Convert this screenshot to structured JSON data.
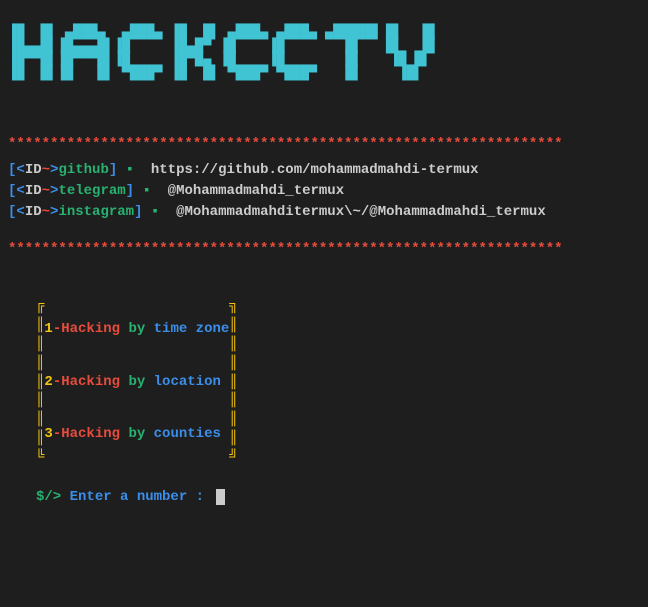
{
  "banner": " _     _ _______ _______ _     _ _______ _______ _______ _    _\n |_____| |_____| |       |____/  |       |          |     \\  /\n |     | |     | |_____  |    \\_ |_____  |_____     |      \\/",
  "separator": "******************************************************************",
  "info": [
    {
      "open": "[",
      "id_open": "<",
      "id": "ID",
      "tilde": "~",
      "id_close": ">",
      "key": "github",
      "close": "]",
      "dot": " ▪  ",
      "link": "https://github.com/mohammadmahdi-termux"
    },
    {
      "open": "[",
      "id_open": "<",
      "id": "ID",
      "tilde": "~",
      "id_close": ">",
      "key": "telegram",
      "close": "]",
      "dot": " ▪  ",
      "link": "@Mohammadmahdi_termux"
    },
    {
      "open": "[",
      "id_open": "<",
      "id": "ID",
      "tilde": "~",
      "id_close": ">",
      "key": "instagram",
      "close": "]",
      "dot": " ▪  ",
      "link": "@Mohammadmahditermux\\~/@Mohammadmahdi_termux"
    }
  ],
  "menu_border_left": "╔\n║\n║\n║\n║\n║\n║\n║\n╚",
  "menu_border_right": "╗\n║\n║\n║\n║\n║\n║\n║\n╝",
  "menu": [
    {
      "num": "1",
      "dash": "-",
      "hack": "Hacking",
      "by": "by",
      "what": "time zone"
    },
    {
      "num": "2",
      "dash": "-",
      "hack": "Hacking",
      "by": "by",
      "what": "location"
    },
    {
      "num": "3",
      "dash": "-",
      "hack": "Hacking",
      "by": "by",
      "what": "counties"
    }
  ],
  "prompt": {
    "sym": "$/>",
    "text": " Enter a number : "
  }
}
